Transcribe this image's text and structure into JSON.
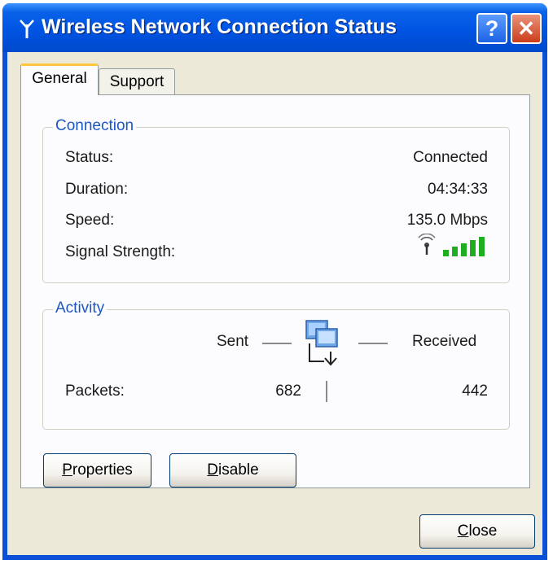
{
  "window": {
    "title": "Wireless Network Connection Status",
    "help_label": "?",
    "close_glyph": "✕",
    "title_icon": "wireless-antenna-icon"
  },
  "tabs": [
    {
      "label": "General",
      "selected": true
    },
    {
      "label": "Support",
      "selected": false
    }
  ],
  "connection": {
    "group_title": "Connection",
    "status_label": "Status:",
    "status_value": "Connected",
    "duration_label": "Duration:",
    "duration_value": "04:34:33",
    "speed_label": "Speed:",
    "speed_value": "135.0 Mbps",
    "signal_label": "Signal Strength:",
    "signal_bars": 5,
    "signal_icon": "signal-strength-icon"
  },
  "activity": {
    "group_title": "Activity",
    "sent_label": "Sent",
    "received_label": "Received",
    "packets_label": "Packets:",
    "packets_sent": "682",
    "packets_received": "442",
    "icon": "network-activity-icon"
  },
  "buttons": {
    "properties_accel": "P",
    "properties_rest": "roperties",
    "disable_accel": "D",
    "disable_rest": "isable",
    "close_accel": "C",
    "close_rest": "lose"
  },
  "colors": {
    "titlebar": "#0054e3",
    "group_title": "#1c57c4",
    "signal_green": "#1fae1f",
    "tab_highlight": "#ffc83c"
  }
}
